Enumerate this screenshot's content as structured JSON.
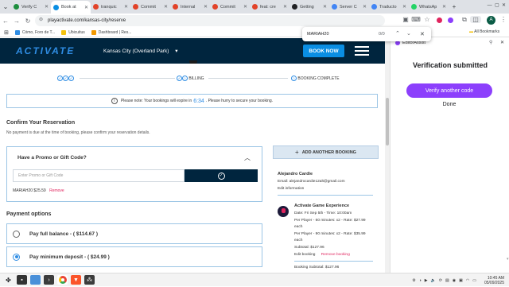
{
  "tabs": [
    {
      "label": "Verify C",
      "color": "#1e8e3e",
      "active": false
    },
    {
      "label": "Book at",
      "color": "#0a8ee3",
      "active": true
    },
    {
      "label": "tranquic",
      "color": "#e24329",
      "active": false
    },
    {
      "label": "Commit",
      "color": "#e24329",
      "active": false
    },
    {
      "label": "Internal",
      "color": "#e24329",
      "active": false
    },
    {
      "label": "Commit",
      "color": "#e24329",
      "active": false
    },
    {
      "label": "feat: cre",
      "color": "#e24329",
      "active": false
    },
    {
      "label": "Getting",
      "color": "#202124",
      "active": false
    },
    {
      "label": "Server C",
      "color": "#4285f4",
      "active": false
    },
    {
      "label": "Traducto",
      "color": "#4285f4",
      "active": false
    },
    {
      "label": "WhatsAp",
      "color": "#25d366",
      "active": false
    }
  ],
  "browser": {
    "new_tab": "+",
    "url": "playactivate.com/kansas-city/reserve",
    "profile_initial": "A",
    "bookmarks": [
      "Cómo, Foro de T...",
      "Ubicuitus",
      "Dashboard | Res..."
    ],
    "all_bookmarks": "All Bookmarks"
  },
  "find": {
    "query": "MARIAH20",
    "count": "0/0"
  },
  "site": {
    "logo": "ACTIVATE",
    "location": "Kansas City (Overland Park)",
    "book_now": "BOOK NOW",
    "steps": {
      "billing": "BILLING",
      "complete": "BOOKING COMPLETE"
    },
    "notice_before": "Please note: Your bookings will expire in",
    "timer": "6:34",
    "notice_after": ". Please hurry to secure your booking.",
    "confirm_title": "Confirm Your Reservation",
    "confirm_sub": "No payment is due at the time of booking, please confirm your reservation details.",
    "promo_title": "Have a Promo or Gift Code?",
    "promo_placeholder": "Enter Promo or Gift Code",
    "applied_code": "MARIAH20 $25.59",
    "remove": "Remove",
    "payment_title": "Payment options",
    "pay_full": "Pay full balance - ( $114.67 )",
    "pay_min": "Pay minimum deposit - ( $24.99 )",
    "add_booking": "ADD ANOTHER BOOKING",
    "customer_name": "Alejandro Cardie",
    "customer_email": "Email: alejandrocardie12alt@gmail.com",
    "edit_info": "Edit information",
    "game_title": "Activate Game Experience",
    "game_date": "Date: Fri Sep 5th - Time: 10:00am",
    "line1a": "Per Player - 60 minutes: x2 - Rate: $27.99",
    "line1b": "each",
    "line2a": "Per Player - 90 minutes: x2 - Rate: $35.99",
    "line2b": "each",
    "subtotal": "Subtotal: $127.96",
    "edit_booking": "Edit booking",
    "remove_booking": "Remove booking",
    "booking_subtotal": "Booking Subtotal: $127.96"
  },
  "panel": {
    "brand": "EditorAssist",
    "title": "Verification submitted",
    "verify_btn": "Verify another code",
    "done": "Done"
  },
  "taskbar": {
    "time": "10:45 AM",
    "date": "05/09/2025"
  },
  "colors": {
    "brand_navy": "#00253e",
    "brand_blue": "#0a8ee3",
    "purple": "#8c3ffc"
  }
}
